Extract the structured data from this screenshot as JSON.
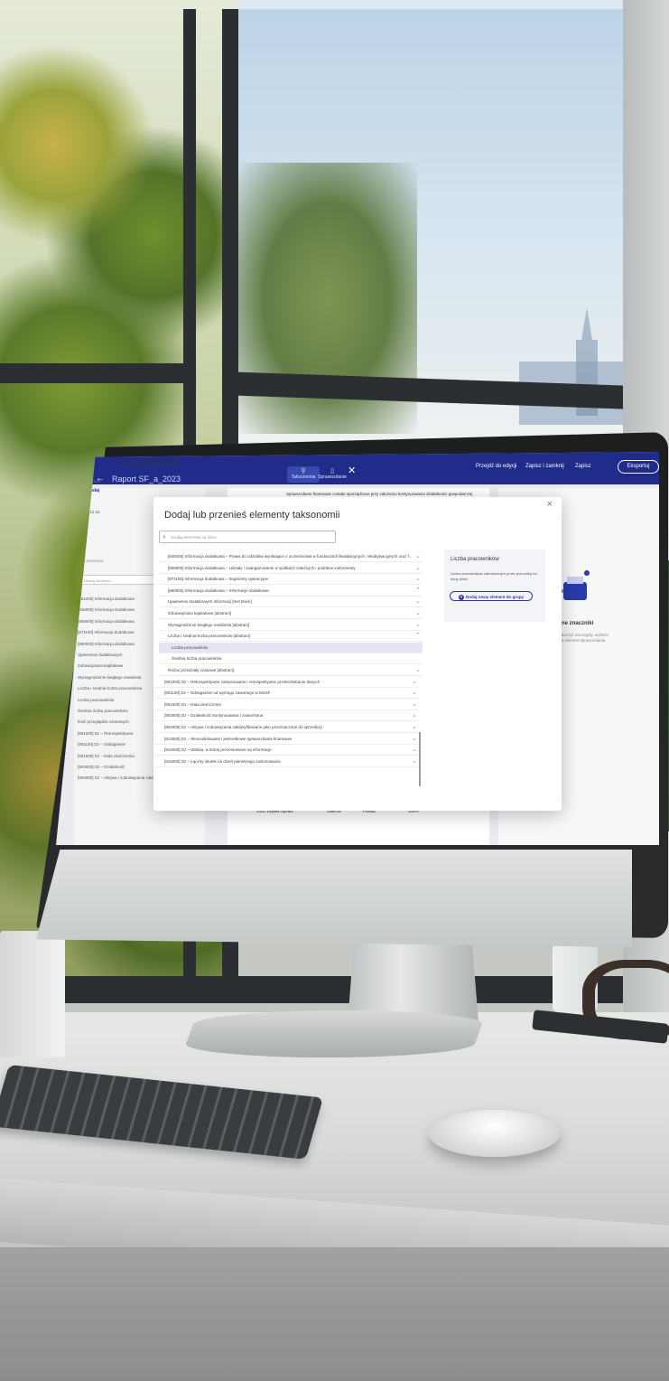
{
  "topbar": {
    "back_icon": "←",
    "doc_title": "Raport SF_a_2023",
    "tabs": [
      "Taksonomia",
      "Sprawozdanie"
    ],
    "close_icon": "✕",
    "actions": [
      "Przejdź do edycji",
      "Zapisz i zamknij",
      "Zapisz"
    ],
    "export_label": "Eksportuj"
  },
  "left_panel": {
    "title": "Lista znaczników XBRL",
    "context_label": "KONTEKST",
    "add_label": "+ Dodaj",
    "date_value": "2022.12.31",
    "taxonomy_label": "TAKSONOMIA",
    "search_placeholder": "Szukaj elementu...",
    "rows": [
      "[861200] Informacja dodatkowa",
      "[846000] Informacja dodatkowa",
      "[868500] Informacja dodatkowa",
      "[871100] Informacja dodatkowa",
      "[880000] Informacja dodatkowa",
      "Ujawnienie dodatkowych",
      "Zobowiązania kapitałowe",
      "Wynagrodzenie biegłego rewidenta",
      "Liczba i średnia liczba pracowników",
      "Liczba pracowników",
      "Średnia liczba pracowników",
      "Ilość przeglądów czasowych",
      "[901000] Dz – Retrospektywne",
      "[901100] Dz – Odstąpienie",
      "[901500] Dz – Data ukończenia",
      "[903000] Dz – Działalność",
      "[904000] Dz – Aktywa i zobowiązania zaklasyfikowane jako..."
    ]
  },
  "document": {
    "heading": "Sprawozdanie finansowe zostało sporządzone przy założeniu kontynuowania działalności gospodarczej",
    "table_row": [
      "ODO Zwykła Spółka",
      "Jednostka zależna",
      "Polska",
      "100%"
    ]
  },
  "right_panel": {
    "title": "Dodane znaczniki",
    "subtitle": "Aby zobaczyć szczegóły, wybierz który na element sprawozdania"
  },
  "modal": {
    "title": "Dodaj lub przenieś elementy taksonomii",
    "close_icon": "×",
    "search_placeholder": "Szukaj elementu na liście",
    "items": [
      "[848200] Informacja dodatkowa – Prawa do udziałów wynikające z uczestnictwa w funduszach likwidacyjnych, rekultywacyjnych oraz f...",
      "[868000] Informacja dodatkowa – Udziały i zaangażowanie w spółkach zależnych i podobne instrumenty",
      "[871100] Informacja dodatkowa – Segmenty operacyjne",
      "[880000] Informacja dodatkowa – Informacje dodatkowe",
      "Ujawnienie dodatkowych informacji [text block]",
      "Zobowiązania kapitałowe [abstract]",
      "Wynagrodzenie biegłego rewidenta [abstract]",
      "Liczba i średnia liczba pracowników [abstract]",
      "Liczba pracowników",
      "Średnia liczba pracowników",
      "Różne przedziały czasowe [abstract]",
      "[901000] Dz – Retrospektywne zastosowanie i retrospektywne przekształcanie danych",
      "[901100] Dz – Odstąpienie od wymogu zawartego w MSSF",
      "[901500] Dz – Data ukończenia",
      "[903000] Dz – Działalność kontynuowana i zaniechana",
      "[904000] Dz – Aktywa i zobowiązania zaklasyfikowane jako przeznaczone do sprzedaży",
      "[913000] Dz – Skonsolidowane i jednostkowe sprawozdania finansowe",
      "[914000] Dz – Waluta, w której prezentowane są informacje",
      "[915000] Dz – Łączny skutek na dzień pierwszego zastosowania"
    ],
    "selected_index": 8,
    "detail": {
      "title": "Liczba pracowników",
      "description": "Liczba pracowników zatrudnionym przez jednostkę na dany dzień",
      "button_label": "Dodaj nowy element do grupy"
    }
  },
  "colors": {
    "topbar": "#1f2c8a",
    "accent": "#2a3aa8",
    "selected_row": "#e6e4f4"
  }
}
